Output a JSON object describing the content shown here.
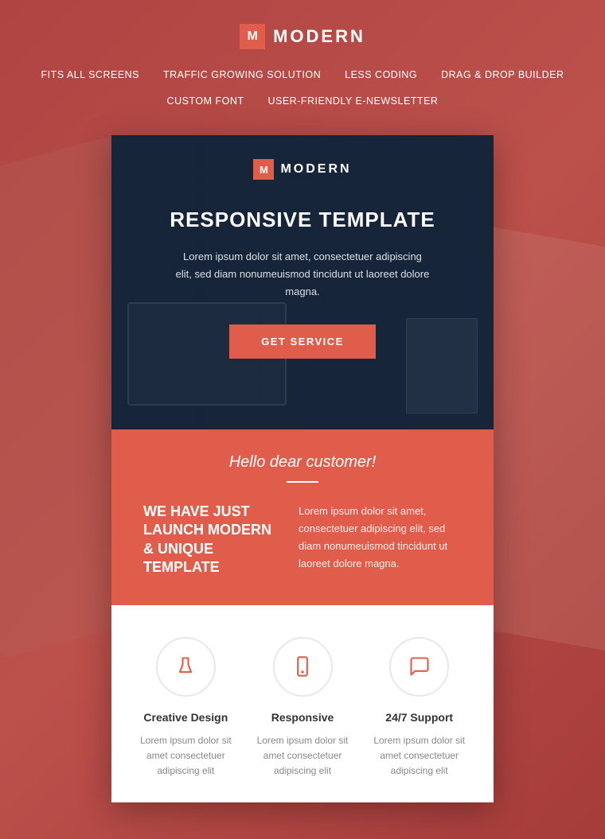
{
  "header": {
    "logo_letter": "M",
    "logo_text": "MODERN",
    "nav_items": [
      "FITS ALL SCREENS",
      "TRAFFIC GROWING SOLUTION",
      "LESS CODING",
      "DRAG & DROP BUILDER",
      "CUSTOM FONT",
      "USER-FRIENDLY E-NEWSLETTER"
    ]
  },
  "hero": {
    "logo_letter": "M",
    "logo_text": "MODERN",
    "title": "RESPONSIVE TEMPLATE",
    "description": "Lorem ipsum dolor sit amet, consectetuer adipiscing elit, sed diam nonumeuismod tincidunt ut laoreet dolore magna.",
    "button_label": "GET SERVICE"
  },
  "coral": {
    "greeting": "Hello dear customer!",
    "heading": "WE HAVE JUST LAUNCH MODERN & UNIQUE TEMPLATE",
    "text": "Lorem ipsum dolor sit amet, consectetuer adipiscing elit, sed diam nonumeuismod tincidunt ut laoreet dolore magna."
  },
  "features": [
    {
      "icon": "flask",
      "title": "Creative Design",
      "desc": "Lorem ipsum dolor sit amet consectetuer adipiscing elit"
    },
    {
      "icon": "mobile",
      "title": "Responsive",
      "desc": "Lorem ipsum dolor sit amet consectetuer adipiscing elit"
    },
    {
      "icon": "chat",
      "title": "24/7 Support",
      "desc": "Lorem ipsum dolor sit amet consectetuer adipiscing elit"
    }
  ],
  "colors": {
    "coral": "#e05c4b",
    "dark_blue": "#1e2d41",
    "white": "#ffffff"
  }
}
